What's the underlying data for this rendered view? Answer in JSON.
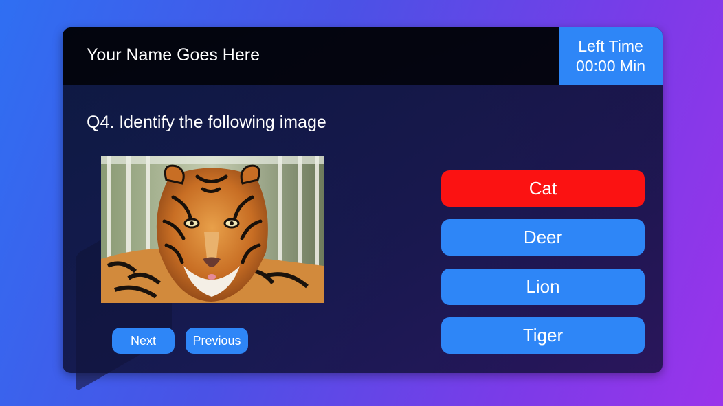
{
  "header": {
    "player_name": "Your Name Goes Here"
  },
  "timer": {
    "label": "Left Time",
    "value": "00:00 Min"
  },
  "question": {
    "text": "Q4. Identify the following image"
  },
  "options": [
    {
      "label": "Cat",
      "state": "wrong",
      "color": "#fb1212"
    },
    {
      "label": "Deer",
      "state": "default",
      "color": "#2e86f7"
    },
    {
      "label": "Lion",
      "state": "default",
      "color": "#2e86f7"
    },
    {
      "label": "Tiger",
      "state": "default",
      "color": "#2e86f7"
    }
  ],
  "nav": {
    "next_label": "Next",
    "previous_label": "Previous"
  },
  "colors": {
    "accent": "#2e86f7",
    "wrong": "#fb1212"
  }
}
